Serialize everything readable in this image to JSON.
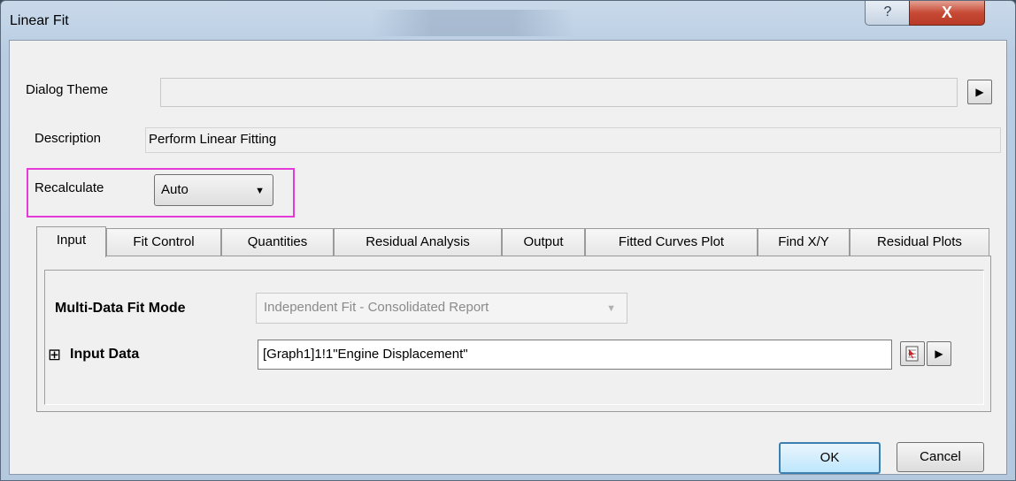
{
  "window": {
    "title": "Linear Fit",
    "help_glyph": "?",
    "close_glyph": "X"
  },
  "theme": {
    "label": "Dialog Theme",
    "value": "",
    "arrow": "▶"
  },
  "description": {
    "label": "Description",
    "value": "Perform Linear Fitting"
  },
  "recalculate": {
    "label": "Recalculate",
    "value": "Auto",
    "arrow": "▼",
    "highlight_color": "#e43ad8"
  },
  "tabs": [
    {
      "label": "Input"
    },
    {
      "label": "Fit Control"
    },
    {
      "label": "Quantities"
    },
    {
      "label": "Residual Analysis"
    },
    {
      "label": "Output"
    },
    {
      "label": "Fitted Curves Plot"
    },
    {
      "label": "Find X/Y"
    },
    {
      "label": "Residual Plots"
    }
  ],
  "input_tab": {
    "mode_label": "Multi-Data Fit Mode",
    "mode_value": "Independent Fit - Consolidated Report",
    "mode_arrow": "▼",
    "expand_glyph": "⊞",
    "data_label": "Input Data",
    "data_value": "[Graph1]1!1\"Engine Displacement\"",
    "arrow": "▶"
  },
  "buttons": {
    "ok": "OK",
    "cancel": "Cancel"
  }
}
